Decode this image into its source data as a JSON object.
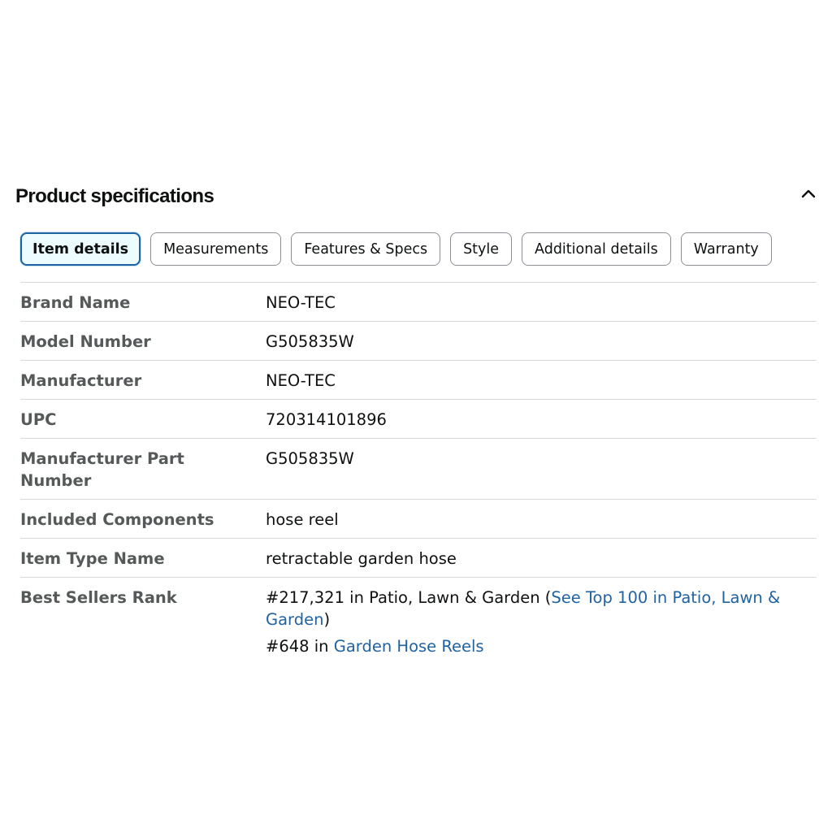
{
  "section": {
    "title": "Product specifications",
    "collapse_icon": "chevron-up-icon"
  },
  "tabs": [
    {
      "label": "Item details",
      "active": true
    },
    {
      "label": "Measurements",
      "active": false
    },
    {
      "label": "Features & Specs",
      "active": false
    },
    {
      "label": "Style",
      "active": false
    },
    {
      "label": "Additional details",
      "active": false
    },
    {
      "label": "Warranty",
      "active": false
    }
  ],
  "specs": {
    "brand": {
      "label": "Brand Name",
      "value": "NEO-TEC"
    },
    "model": {
      "label": "Model Number",
      "value": "G505835W"
    },
    "manufacturer": {
      "label": "Manufacturer",
      "value": "NEO-TEC"
    },
    "upc": {
      "label": "UPC",
      "value": "720314101896"
    },
    "mpn": {
      "label": "Manufacturer Part Number",
      "value": "G505835W"
    },
    "components": {
      "label": "Included Components",
      "value": "hose reel"
    },
    "item_type": {
      "label": "Item Type Name",
      "value": "retractable garden hose"
    },
    "best_sellers": {
      "label": "Best Sellers Rank",
      "rank1_prefix": "#217,321 in Patio, Lawn & Garden (",
      "rank1_link": "See Top 100 in Patio, Lawn & Garden",
      "rank1_suffix": ")",
      "rank2_prefix": "#648 in ",
      "rank2_link": "Garden Hose Reels"
    }
  },
  "colors": {
    "link": "#2162a1",
    "label": "#565959",
    "text": "#0f1111",
    "divider": "#d5d9d9",
    "active_tab_border": "#2162a1",
    "active_tab_bg": "#edfdff"
  }
}
